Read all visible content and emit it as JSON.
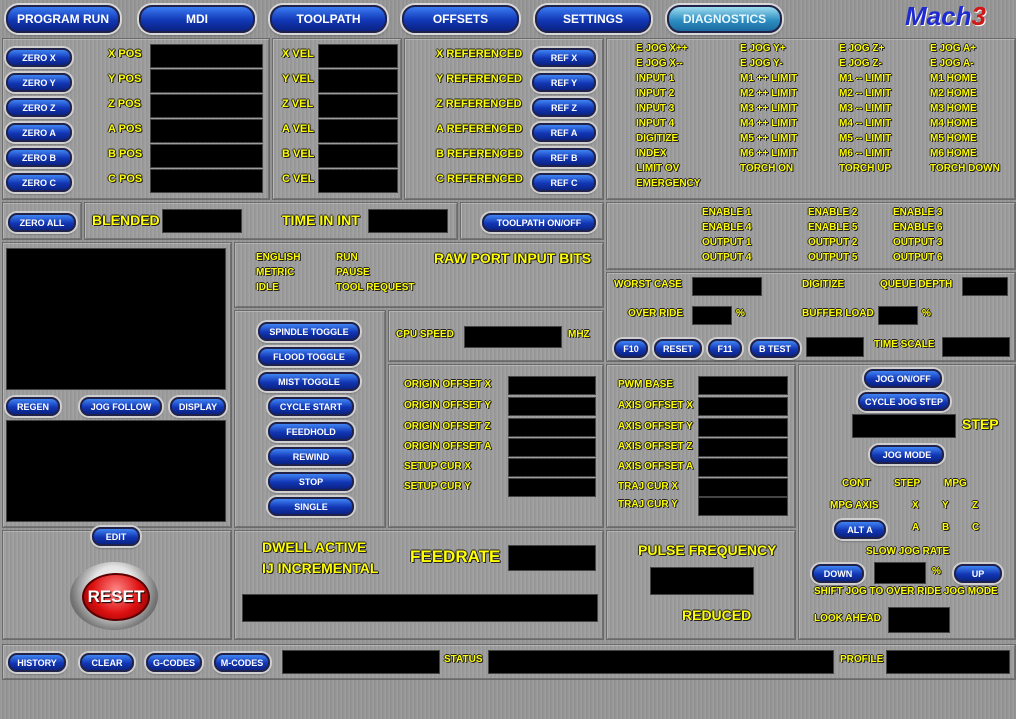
{
  "app": {
    "logo_main": "Mach",
    "logo_num": "3"
  },
  "tabs": [
    "PROGRAM RUN",
    "MDI",
    "TOOLPATH",
    "OFFSETS",
    "SETTINGS",
    "DIAGNOSTICS"
  ],
  "zero_buttons": [
    "ZERO X",
    "ZERO Y",
    "ZERO Z",
    "ZERO A",
    "ZERO B",
    "ZERO C"
  ],
  "pos_labels": [
    "X POS",
    "Y POS",
    "Z POS",
    "A POS",
    "B POS",
    "C POS"
  ],
  "vel_labels": [
    "X VEL",
    "Y VEL",
    "Z VEL",
    "A VEL",
    "B VEL",
    "C VEL"
  ],
  "ref_labels": [
    "X REFERENCED",
    "Y REFERENCED",
    "Z REFERENCED",
    "A REFERENCED",
    "B REFERENCED",
    "C REFERENCED"
  ],
  "ref_buttons": [
    "REF X",
    "REF Y",
    "REF Z",
    "REF A",
    "REF B",
    "REF C"
  ],
  "signals": {
    "col1": [
      "E JOG X++",
      "E JOG X--",
      "INPUT 1",
      "INPUT 2",
      "INPUT 3",
      "INPUT 4",
      "DIGITIZE",
      "INDEX",
      "LIMIT OV",
      "EMERGENCY"
    ],
    "col2": [
      "E JOG Y+",
      "E JOG Y-",
      "M1 ++ LIMIT",
      "M2 ++ LIMIT",
      "M3 ++ LIMIT",
      "M4 ++ LIMIT",
      "M5 ++ LIMIT",
      "M6 ++ LIMIT",
      "TORCH ON"
    ],
    "col3": [
      "E JOG Z+",
      "E JOG Z-",
      "M1 -- LIMIT",
      "M2 -- LIMIT",
      "M3 -- LIMIT",
      "M4 -- LIMIT",
      "M5 -- LIMIT",
      "M6 -- LIMIT",
      "TORCH UP"
    ],
    "col4": [
      "E JOG A+",
      "E JOG A-",
      "M1 HOME",
      "M2 HOME",
      "M3 HOME",
      "M4 HOME",
      "M5 HOME",
      "M6 HOME",
      "TORCH DOWN"
    ]
  },
  "zero_all": "ZERO ALL",
  "blended": "BLENDED",
  "time_in_int": "TIME IN INT",
  "toolpath_toggle": "TOOLPATH ON/OFF",
  "outputs": {
    "col1": [
      "ENABLE 1",
      "ENABLE 4",
      "OUTPUT 1",
      "OUTPUT 4"
    ],
    "col2": [
      "ENABLE 2",
      "ENABLE 5",
      "OUTPUT 2",
      "OUTPUT 5"
    ],
    "col3": [
      "ENABLE 3",
      "ENABLE 6",
      "OUTPUT 3",
      "OUTPUT 6"
    ]
  },
  "mode_status": {
    "col1": [
      "ENGLISH",
      "METRIC",
      "IDLE"
    ],
    "col2": [
      "RUN",
      "PAUSE",
      "TOOL REQUEST"
    ],
    "raw_port": "RAW PORT INPUT BITS"
  },
  "worst_case": "WORST CASE",
  "digitize": "DIGITIZE",
  "queue_depth": "QUEUE DEPTH",
  "over_ride": "OVER RIDE",
  "pct": "%",
  "buffer_load": "BUFFER LOAD",
  "time_scale": "TIME SCALE",
  "diag_buttons": [
    "F10",
    "RESET",
    "F11",
    "B TEST"
  ],
  "toolpath_buttons": [
    "REGEN",
    "JOG FOLLOW",
    "DISPLAY"
  ],
  "machine_buttons": [
    "SPINDLE TOGGLE",
    "FLOOD TOGGLE",
    "MIST TOGGLE",
    "CYCLE START",
    "FEEDHOLD",
    "REWIND",
    "STOP",
    "SINGLE"
  ],
  "cpu_speed": "CPU SPEED",
  "mhz": "MHZ",
  "origin_labels": [
    "ORIGIN OFFSET X",
    "ORIGIN OFFSET Y",
    "ORIGIN OFFSET Z",
    "ORIGIN OFFSET A",
    "SETUP CUR X",
    "SETUP CUR Y"
  ],
  "axis_labels": [
    "PWM BASE",
    "AXIS OFFSET X",
    "AXIS OFFSET Y",
    "AXIS OFFSET Z",
    "AXIS OFFSET A",
    "TRAJ CUR X",
    "TRAJ CUR Y"
  ],
  "jog": {
    "on_off": "JOG ON/OFF",
    "cycle_step": "CYCLE JOG STEP",
    "step": "STEP",
    "mode": "JOG MODE",
    "cont": "CONT",
    "step2": "STEP",
    "mpg": "MPG",
    "mpg_axis": "MPG AXIS",
    "alt_a": "ALT A",
    "x": "X",
    "y": "Y",
    "z": "Z",
    "a": "A",
    "b": "B",
    "c": "C",
    "slow_jog_rate": "SLOW JOG RATE",
    "down": "DOWN",
    "up": "UP",
    "shift_jog": "SHIFT JOG TO OVER RIDE JOG MODE",
    "look_ahead": "LOOK AHEAD"
  },
  "edit": "EDIT",
  "reset": "RESET",
  "dwell_active": "DWELL ACTIVE",
  "ij_incremental": "IJ INCREMENTAL",
  "feedrate": "FEEDRATE",
  "pulse_frequency": "PULSE FREQUENCY",
  "reduced": "REDUCED",
  "bottom_buttons": [
    "HISTORY",
    "CLEAR",
    "G-CODES",
    "M-CODES"
  ],
  "status": "STATUS",
  "profile": "PROFILE"
}
